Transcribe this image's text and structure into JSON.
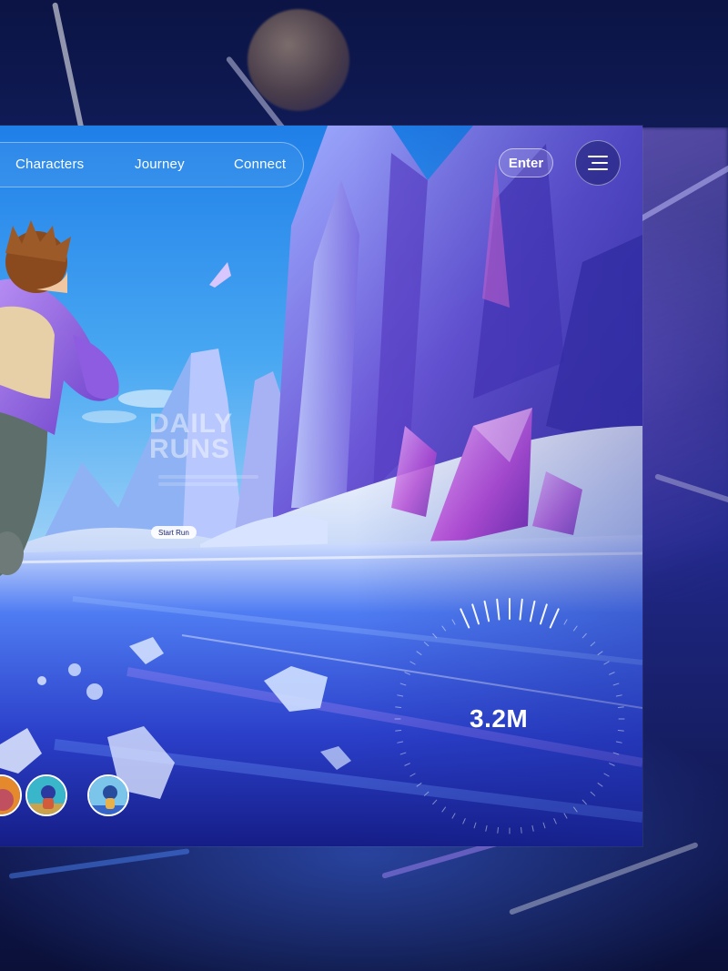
{
  "nav": {
    "links": [
      "Characters",
      "Journey",
      "Connect"
    ],
    "enter_label": "Enter",
    "menu_icon": "hamburger-menu-icon"
  },
  "hero": {
    "title_line1": "DAILY",
    "title_line2": "RUNS",
    "cta_label": "Start Run"
  },
  "stat": {
    "value": "3.2M"
  },
  "avatars": [
    {
      "name": "character-avatar-1",
      "palette": [
        "#f0a030",
        "#c05060"
      ]
    },
    {
      "name": "character-avatar-2",
      "palette": [
        "#39b6c9",
        "#c9a24b"
      ]
    },
    {
      "name": "character-avatar-3",
      "palette": [
        "#3565c9",
        "#7bc4ea"
      ]
    }
  ],
  "colors": {
    "accent": "#7b4de0",
    "ice": "#4aa6ff",
    "crystal": "#c04fd8",
    "sky": "#2f8df0"
  }
}
